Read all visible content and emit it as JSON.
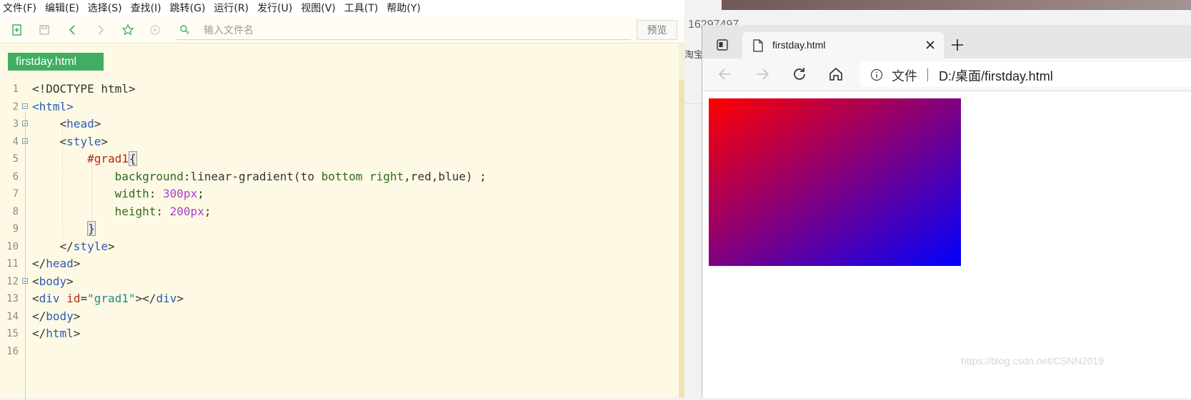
{
  "editor": {
    "menu": [
      "文件(F)",
      "编辑(E)",
      "选择(S)",
      "查找(I)",
      "跳转(G)",
      "运行(R)",
      "发行(U)",
      "视图(V)",
      "工具(T)",
      "帮助(Y)"
    ],
    "filename_placeholder": "输入文件名",
    "preview_label": "预览",
    "file_tab": "firstday.html",
    "line_numbers": [
      "1",
      "2",
      "3",
      "4",
      "5",
      "6",
      "7",
      "8",
      "9",
      "10",
      "11",
      "12",
      "13",
      "14",
      "15",
      "16"
    ]
  },
  "code": {
    "l1": "<!DOCTYPE html>",
    "l2_open": "<",
    "l2_tag": "html",
    "l2_close": ">",
    "l3_indent": "    ",
    "l3_open": "<",
    "l3_tag": "head",
    "l3_close": ">",
    "l4_indent": "    ",
    "l4_open": "<",
    "l4_tag": "style",
    "l4_close": ">",
    "l5_indent": "        ",
    "l5_sel": "#grad1",
    "l5_brace": "{",
    "l6_indent": "            ",
    "l6_prop": "background",
    "l6_rest_a": ":linear-gradient(to ",
    "l6_kw": "bottom right",
    "l6_rest_b": ",red,blue) ;",
    "l7_indent": "            ",
    "l7_prop": "width",
    "l7_colon": ": ",
    "l7_num": "300px",
    "l7_semi": ";",
    "l8_indent": "            ",
    "l8_prop": "height",
    "l8_colon": ": ",
    "l8_num": "200px",
    "l8_semi": ";",
    "l9_indent": "        ",
    "l9_brace": "}",
    "l10_indent": "    ",
    "l10_open": "</",
    "l10_tag": "style",
    "l10_close": ">",
    "l11_open": "</",
    "l11_tag": "head",
    "l11_close": ">",
    "l12_open": "<",
    "l12_tag": "body",
    "l12_close": ">",
    "l13_a": "<",
    "l13_tag": "div",
    "l13_sp": " ",
    "l13_attr": "id",
    "l13_eq": "=",
    "l13_val": "\"grad1\"",
    "l13_b": "></",
    "l13_tag2": "div",
    "l13_c": ">",
    "l14_open": "</",
    "l14_tag": "body",
    "l14_close": ">",
    "l15_open": "</",
    "l15_tag": "html",
    "l15_close": ">"
  },
  "background_window": {
    "number_text": "16297497",
    "shop_text": "淘宝"
  },
  "browser": {
    "tab_title": "firstday.html",
    "address_label": "文件",
    "address_url": "D:/桌面/firstday.html",
    "gradient": {
      "direction": "to bottom right",
      "from": "#ff0000",
      "to": "#0000ff"
    }
  },
  "watermark": "https://blog.csdn.net/CSNN2019",
  "colors": {
    "file_tab_bg": "#3fae64",
    "editor_bg": "#fef9e5",
    "tag": "#2b5bb3",
    "selector": "#b22a10",
    "property": "#2d6b1e",
    "number": "#a83ed0"
  }
}
